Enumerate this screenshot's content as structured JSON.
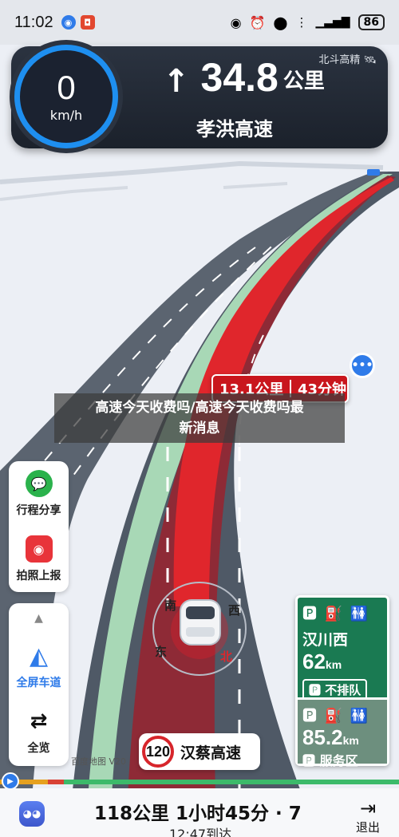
{
  "status_bar": {
    "time": "11:02",
    "battery": "86"
  },
  "nav": {
    "speed_value": "0",
    "speed_unit": "km/h",
    "next_distance": "34.8",
    "next_distance_unit": "公里",
    "road_name": "孝洪高速",
    "provider": "北斗高精"
  },
  "route_pill": {
    "distance": "13.1公里",
    "time": "43分钟"
  },
  "title_overlay": {
    "line1": "高速今天收费吗/高速今天收费吗最",
    "line2": "新消息"
  },
  "side_panel": {
    "trip_share": "行程分享",
    "photo_report": "拍照上报",
    "fullscreen": "全屏车道",
    "overview": "全览"
  },
  "compass": {
    "south": "南",
    "west": "西",
    "east": "东",
    "north": "北"
  },
  "service_sign": {
    "name": "汉川西",
    "distance": "62",
    "distance_unit": "km",
    "status": "不排队",
    "next_distance": "85.2",
    "next_distance_unit": "km",
    "next_type": "服务区"
  },
  "road_shield": {
    "speed_limit": "120",
    "road_name": "汉蔡高速"
  },
  "watermark": "百度地图 V20",
  "bottom_bar": {
    "summary": "118公里 1小时45分 · 7",
    "arrival": "12:47到达",
    "exit_label": "退出"
  },
  "colors": {
    "route_red": "#c9161d",
    "route_green": "#a8d8b6",
    "accent_blue": "#1e8ff0",
    "sign_green": "#1a7a52"
  }
}
